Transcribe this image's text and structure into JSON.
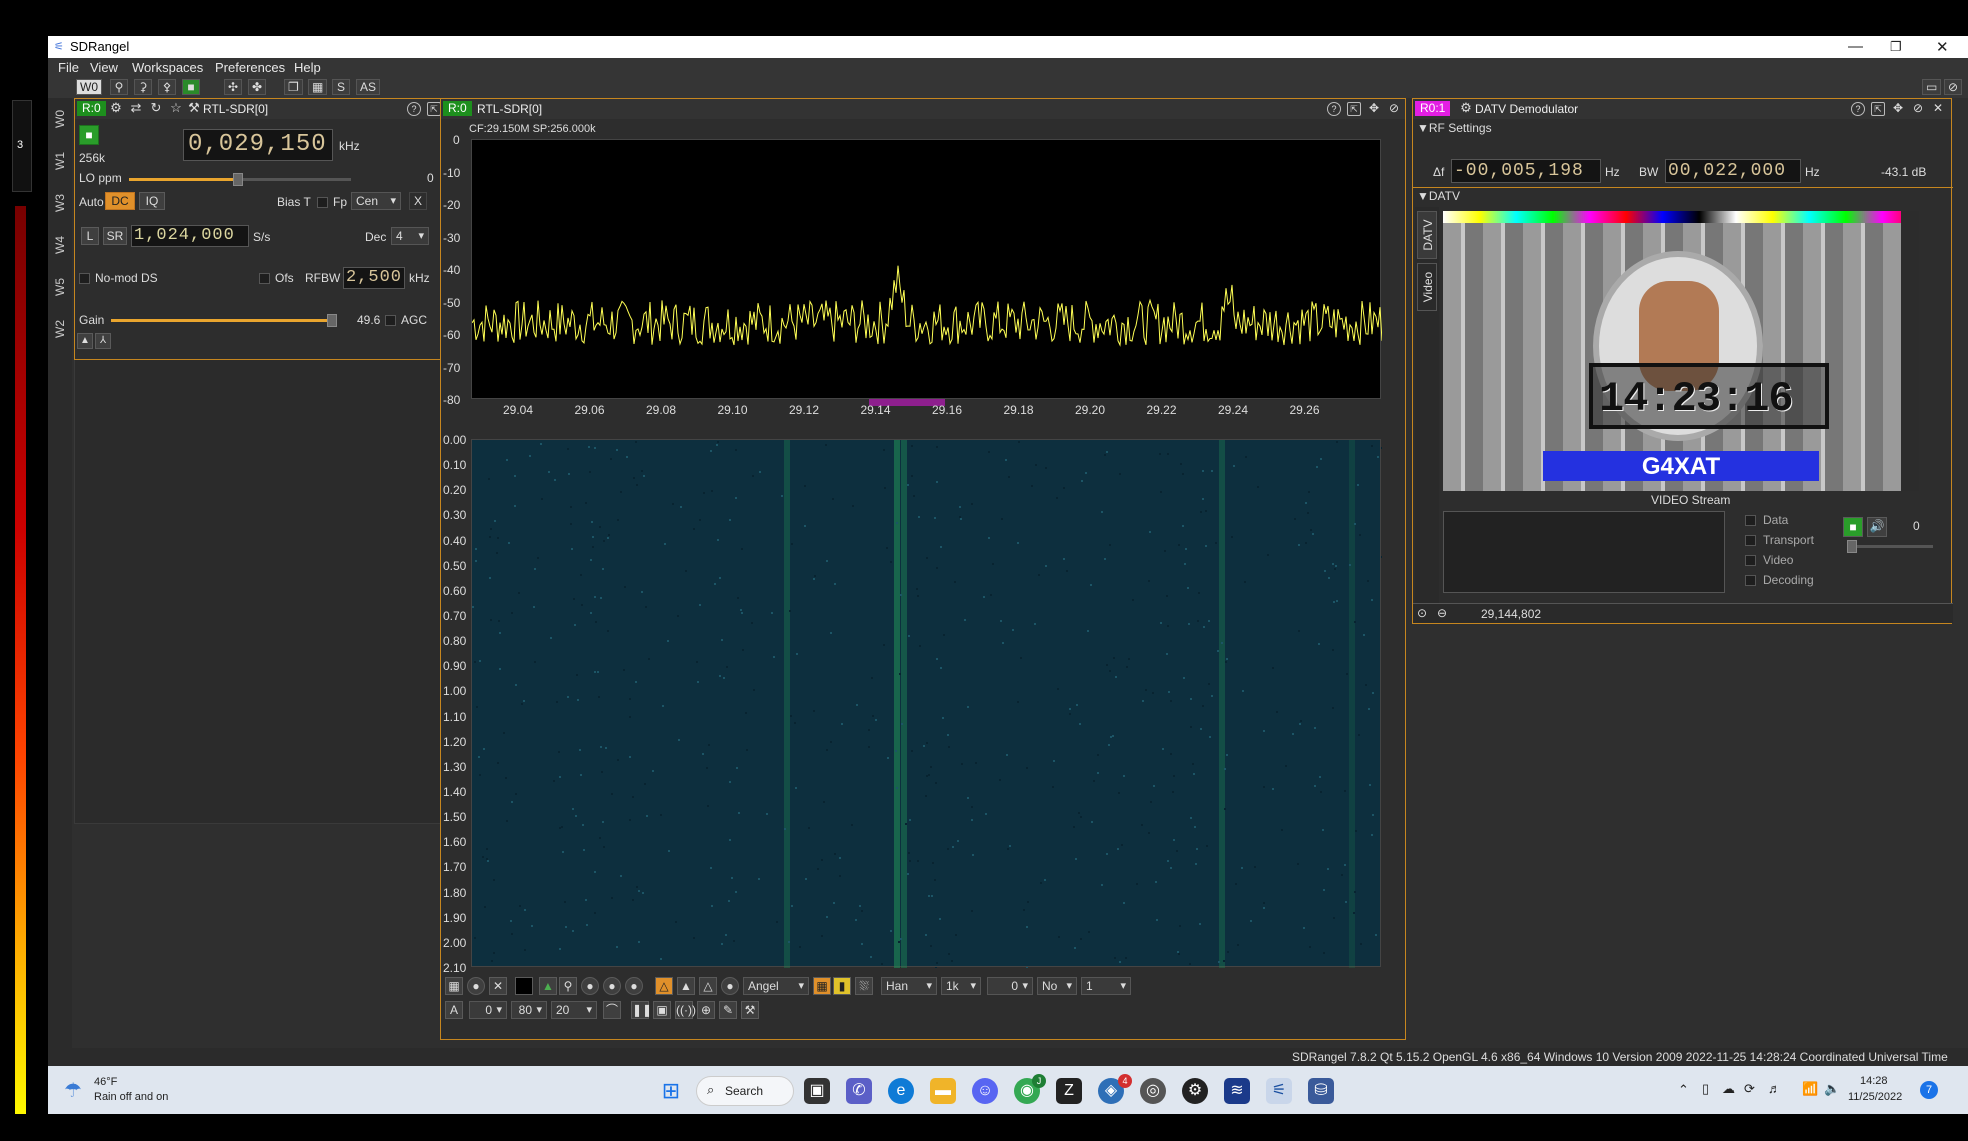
{
  "app": {
    "title": "SDRangel"
  },
  "menu": {
    "file": "File",
    "view": "View",
    "workspaces": "Workspaces",
    "preferences": "Preferences",
    "help": "Help"
  },
  "toolbar": {
    "workspace": "W0",
    "s": "S",
    "as": "AS"
  },
  "workspaces": [
    "W0",
    "W1",
    "W3",
    "W4",
    "W5",
    "W2"
  ],
  "colorbar_label": "3",
  "device_panel": {
    "tag": "R:0",
    "name": "RTL-SDR[0]",
    "sample_rate_label": "256k",
    "frequency": "0,029,150",
    "frequency_unit": "kHz",
    "lo_ppm_label": "LO ppm",
    "lo_ppm_value": "0",
    "auto": "Auto",
    "dc": "DC",
    "iq": "IQ",
    "bias_t": "Bias T",
    "fp": "Fp",
    "fp_mode": "Cen",
    "x": "X",
    "l": "L",
    "sr": "SR",
    "sr_value": "1,024,000",
    "sr_unit": "S/s",
    "dec_label": "Dec",
    "dec_value": "4",
    "no_mod_ds": "No-mod DS",
    "ofs": "Ofs",
    "rfbw_label": "RFBW",
    "rfbw_value": "2,500",
    "rfbw_unit": "kHz",
    "gain_label": "Gain",
    "gain_value": "49.6",
    "gain_fraction": 0.96,
    "agc": "AGC"
  },
  "spectrum_panel": {
    "tag": "R:0",
    "name": "RTL-SDR[0]",
    "info": "CF:29.150M SP:256.000k",
    "y_ticks": [
      "0",
      "-10",
      "-20",
      "-30",
      "-40",
      "-50",
      "-60",
      "-70",
      "-80"
    ],
    "x_ticks": [
      "29.04",
      "29.06",
      "29.08",
      "29.10",
      "29.12",
      "29.14",
      "29.16",
      "29.18",
      "29.20",
      "29.22",
      "29.24",
      "29.26"
    ],
    "wf_ticks": [
      "0.00",
      "0.10",
      "0.20",
      "0.30",
      "0.40",
      "0.50",
      "0.60",
      "0.70",
      "0.80",
      "0.90",
      "1.00",
      "1.10",
      "1.20",
      "1.30",
      "1.40",
      "1.50",
      "1.60",
      "1.70",
      "1.80",
      "1.90",
      "2.00",
      "2.10"
    ],
    "trace_color": "#ffff55",
    "controls": {
      "palette": "Angel",
      "window": "Han",
      "fft_size": "1k",
      "ref_value": "0",
      "overlap": "No",
      "avg": "1",
      "a_label": "A",
      "a_value": "0",
      "range": "80",
      "fps": "20"
    }
  },
  "datv_panel": {
    "tag": "R0:1",
    "name": "DATV Demodulator",
    "rf_settings": "RF Settings",
    "delta_label": "Δf",
    "delta_value": "-00,005,198",
    "delta_unit": "Hz",
    "bw_label": "BW",
    "bw_value": "00,022,000",
    "bw_unit": "Hz",
    "power": "-43.1 dB",
    "datv_section": "DATV",
    "side_tabs": [
      "DATV",
      "Video"
    ],
    "video_stream": "VIDEO Stream",
    "clock_text": "14:23:16",
    "callsign": "G4XAT",
    "status_items": [
      "Data",
      "Transport",
      "Video",
      "Decoding"
    ],
    "audio_value": "0",
    "frequency": "29,144,802"
  },
  "statusbar": {
    "text": "SDRangel 7.8.2 Qt 5.15.2 OpenGL 4.6 x86_64 Windows 10 Version 2009  2022-11-25 14:28:24 Coordinated Universal Time"
  },
  "taskbar": {
    "weather_temp": "46°F",
    "weather_desc": "Rain off and on",
    "search": "Search",
    "time": "14:28",
    "date": "11/25/2022",
    "badge_chrome": "J",
    "badge_app": "4",
    "notif": "7"
  }
}
